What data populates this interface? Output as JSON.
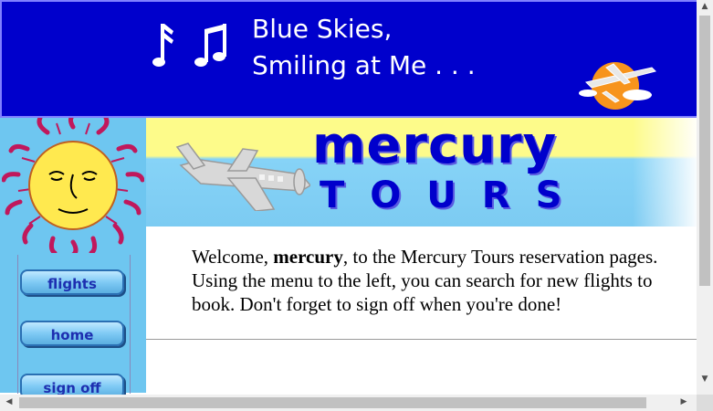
{
  "banner": {
    "tagline": "Blue Skies,\nSmiling at Me . . .",
    "notes_icon": "music-notes-icon",
    "logo_icon": "plane-sun-logo"
  },
  "sidebar": {
    "sun_icon": "sun-face-icon",
    "nav": [
      {
        "label": "flights"
      },
      {
        "label": "home"
      },
      {
        "label": "sign off"
      }
    ]
  },
  "header": {
    "title": "mercury",
    "subtitle": "TOURS",
    "plane_icon": "airplane-icon"
  },
  "welcome": {
    "prefix": "Welcome, ",
    "username": "mercury",
    "suffix": ", to the Mercury Tours reservation pages. Using the menu to the left, you can search for new flights to book. Don't forget to sign off when you're done!"
  },
  "colors": {
    "banner_bg": "#0000cc",
    "sidebar_bg": "#6ec6f0",
    "header_yellow": "#fdfb8a",
    "header_blue": "#86d3f7",
    "title_blue": "#0000cc"
  }
}
